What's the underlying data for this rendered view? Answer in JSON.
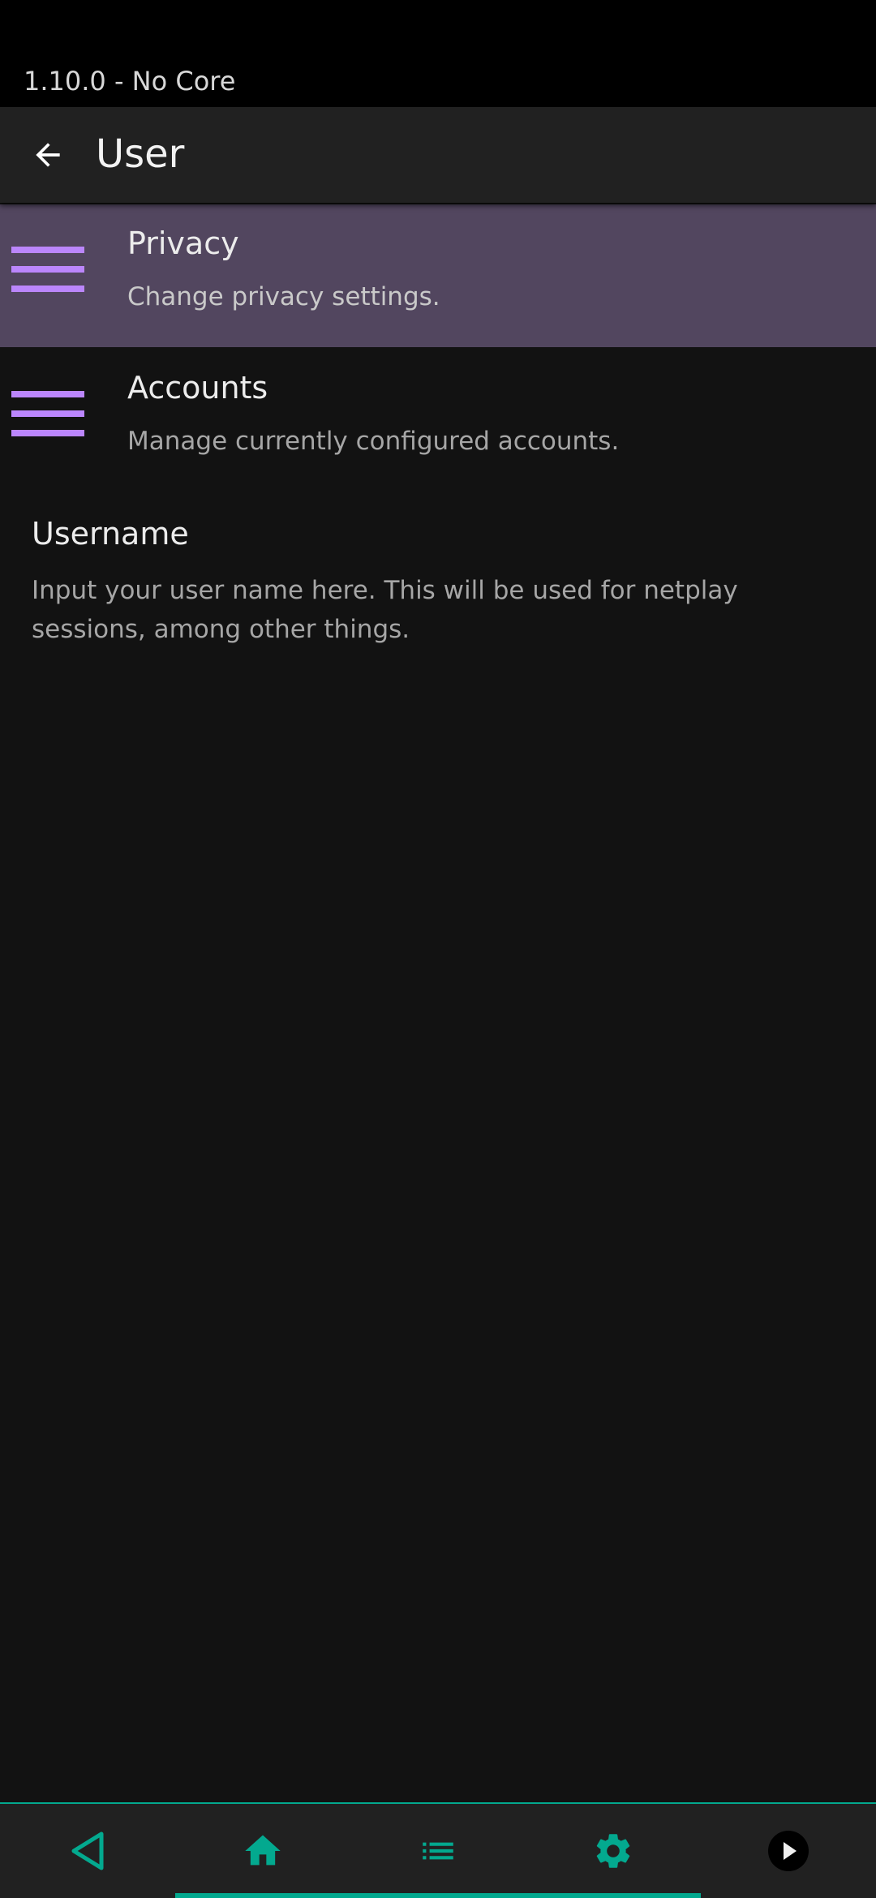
{
  "status_bar": {
    "version_text": "1.10.0 - No Core"
  },
  "header": {
    "title": "User",
    "back_icon": "arrow-left-icon"
  },
  "items": [
    {
      "title": "Privacy",
      "subtitle": "Change privacy settings.",
      "icon": "menu-lines-icon",
      "selected": true
    },
    {
      "title": "Accounts",
      "subtitle": "Manage currently configured accounts.",
      "icon": "menu-lines-icon",
      "selected": false
    }
  ],
  "setting": {
    "title": "Username",
    "description": "Input your user name here. This will be used for netplay sessions, among other things."
  },
  "bottom_nav": {
    "items": [
      {
        "icon": "back-triangle-icon"
      },
      {
        "icon": "home-icon"
      },
      {
        "icon": "list-icon"
      },
      {
        "icon": "gear-icon"
      },
      {
        "icon": "play-circle-icon"
      }
    ]
  },
  "colors": {
    "accent": "#03a98f",
    "icon_purple": "#bb86fc",
    "selected_row": "#52465f",
    "background": "#121212",
    "bar": "#212121"
  }
}
